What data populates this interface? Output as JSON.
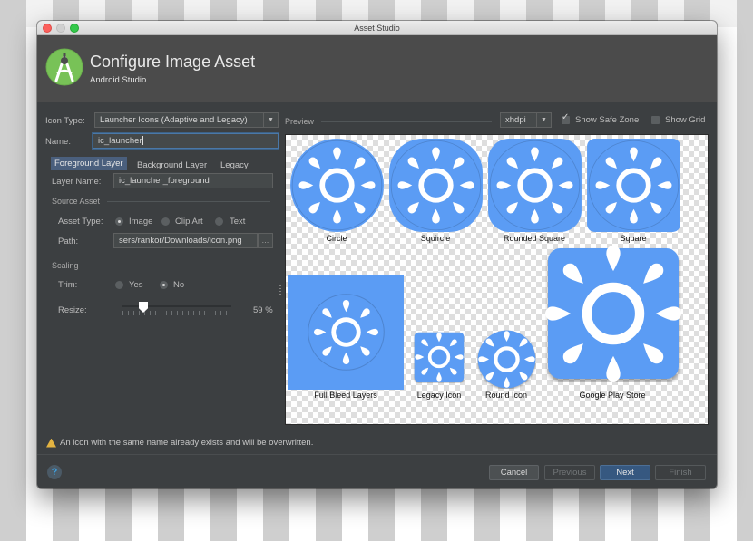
{
  "window": {
    "title": "Asset Studio"
  },
  "header": {
    "title": "Configure Image Asset",
    "subtitle": "Android Studio"
  },
  "form": {
    "icon_type_label": "Icon Type:",
    "icon_type_value": "Launcher Icons (Adaptive and Legacy)",
    "name_label": "Name:",
    "name_value": "ic_launcher",
    "tabs": [
      {
        "label": "Foreground Layer",
        "active": true
      },
      {
        "label": "Background Layer",
        "active": false
      },
      {
        "label": "Legacy",
        "active": false
      }
    ],
    "layer_name_label": "Layer Name:",
    "layer_name_value": "ic_launcher_foreground",
    "source_asset_section": "Source Asset",
    "asset_type_label": "Asset Type:",
    "asset_type_options": [
      {
        "label": "Image",
        "selected": true
      },
      {
        "label": "Clip Art",
        "selected": false
      },
      {
        "label": "Text",
        "selected": false
      }
    ],
    "path_label": "Path:",
    "path_value": "sers/rankor/Downloads/icon.png",
    "browse_label": "...",
    "scaling_section": "Scaling",
    "trim_label": "Trim:",
    "trim_options": [
      {
        "label": "Yes",
        "selected": false
      },
      {
        "label": "No",
        "selected": true
      }
    ],
    "resize_label": "Resize:",
    "resize_percent": 59,
    "resize_text": "59 %"
  },
  "preview": {
    "label": "Preview",
    "density_value": "xhdpi",
    "show_safe_zone_label": "Show Safe Zone",
    "show_safe_zone_checked": true,
    "show_grid_label": "Show Grid",
    "show_grid_checked": false,
    "icon_color": "#5b9cf4",
    "items": [
      {
        "caption": "Circle",
        "shape": "circle"
      },
      {
        "caption": "Squircle",
        "shape": "squircle"
      },
      {
        "caption": "Rounded Square",
        "shape": "rounded-square"
      },
      {
        "caption": "Square",
        "shape": "square"
      },
      {
        "caption": "Full Bleed Layers",
        "shape": "full-bleed"
      },
      {
        "caption": "Legacy Icon",
        "shape": "legacy"
      },
      {
        "caption": "Round Icon",
        "shape": "round"
      },
      {
        "caption": "Google Play Store",
        "shape": "play-store"
      }
    ]
  },
  "footer": {
    "warning_text": "An icon with the same name already exists and will be overwritten.",
    "help_label": "?",
    "buttons": {
      "cancel": "Cancel",
      "previous": "Previous",
      "next": "Next",
      "finish": "Finish"
    }
  }
}
